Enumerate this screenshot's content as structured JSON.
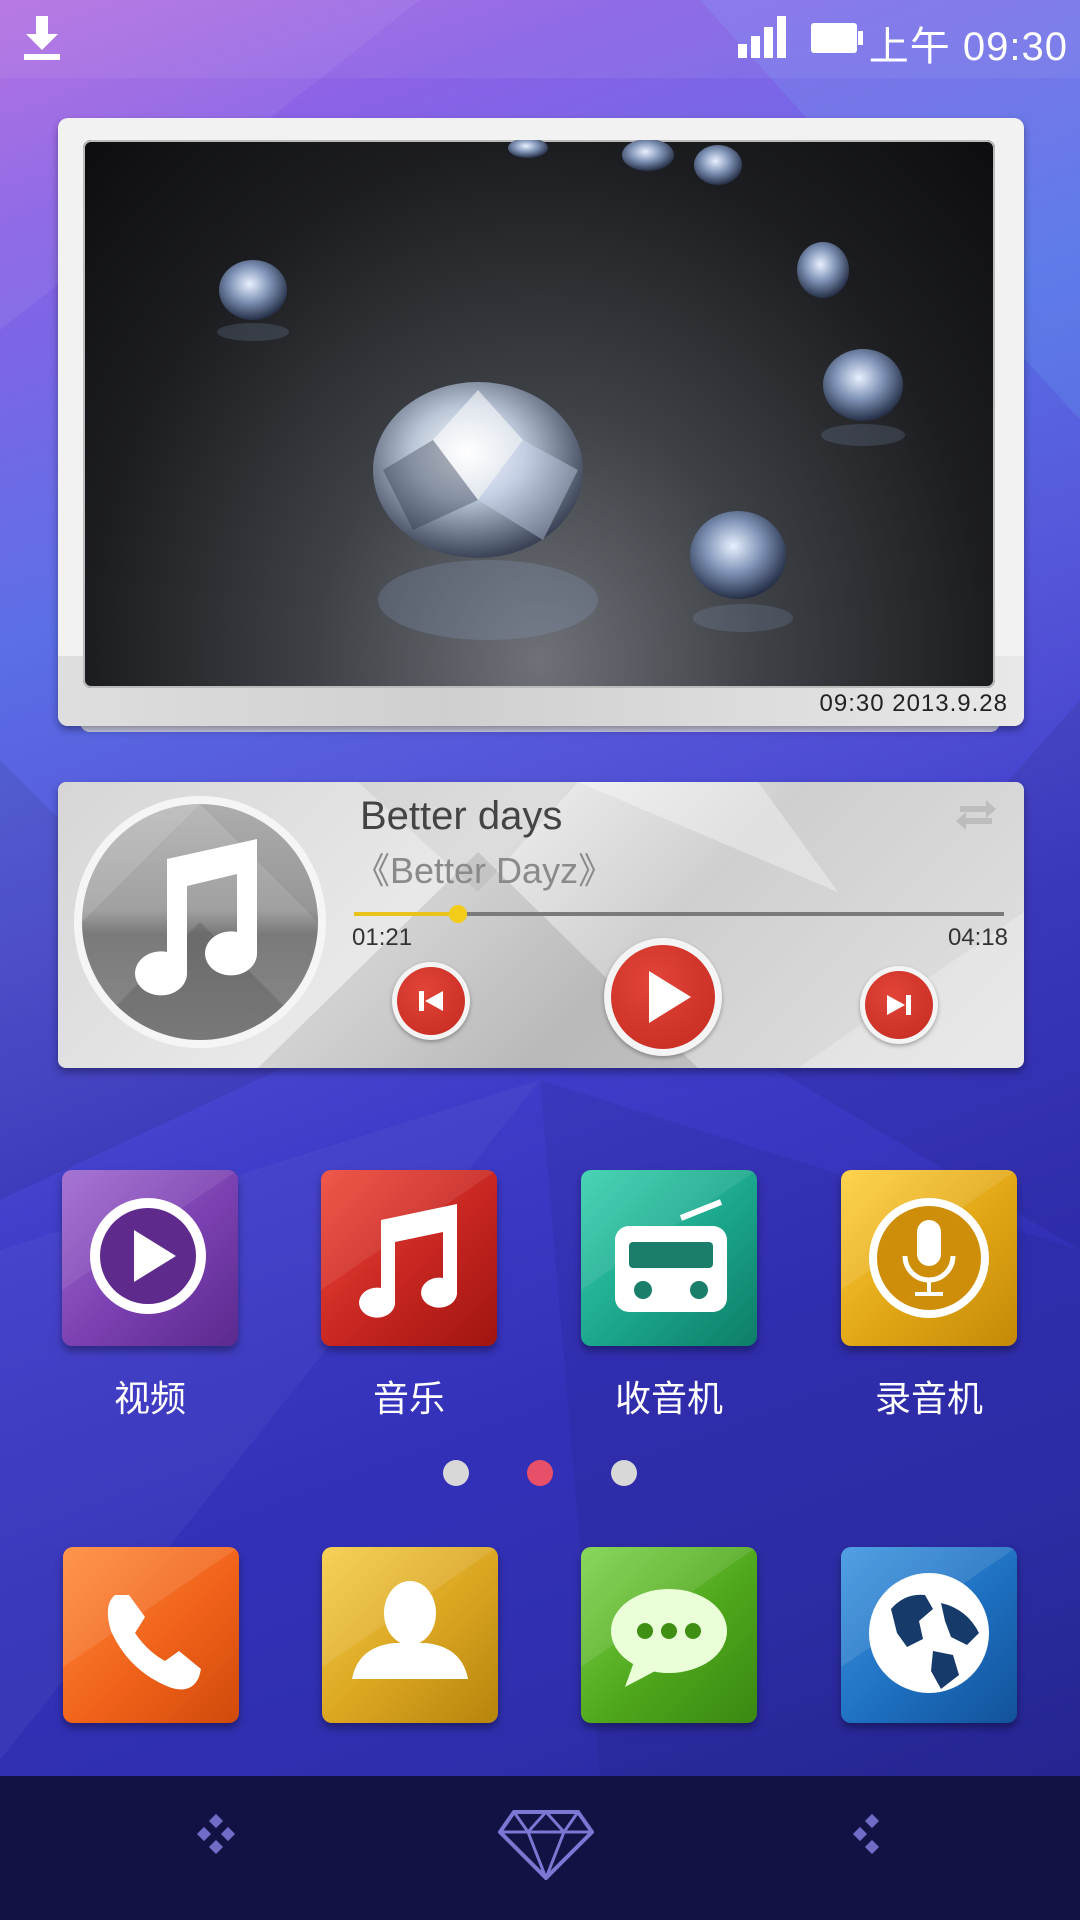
{
  "status_bar": {
    "time": "上午 09:30",
    "icons": [
      "download-icon",
      "signal-icon",
      "battery-icon"
    ]
  },
  "photo_widget": {
    "timestamp": "09:30  2013.9.28"
  },
  "music_widget": {
    "title": "Better days",
    "album": "《Better Dayz》",
    "elapsed": "01:21",
    "duration": "04:18",
    "progress": 0.16,
    "icons": [
      "music-note-icon",
      "repeat-icon",
      "previous-icon",
      "play-icon",
      "next-icon"
    ]
  },
  "apps_row1": [
    {
      "label": "视频",
      "icon": "video-icon",
      "color": "#7a3fb0"
    },
    {
      "label": "音乐",
      "icon": "music-icon",
      "color": "#c62520"
    },
    {
      "label": "收音机",
      "icon": "radio-icon",
      "color": "#1aa58a"
    },
    {
      "label": "录音机",
      "icon": "microphone-icon",
      "color": "#e0a514"
    }
  ],
  "page_indicator": {
    "count": 3,
    "active": 1
  },
  "apps_row2": [
    {
      "icon": "phone-icon",
      "color": "#f0621a"
    },
    {
      "icon": "contacts-icon",
      "color": "#d9a420"
    },
    {
      "icon": "messages-icon",
      "color": "#4fa71c"
    },
    {
      "icon": "browser-icon",
      "color": "#1e6fc0"
    }
  ],
  "dock": {
    "icons": [
      "left-menu-icon",
      "diamond-icon",
      "right-menu-icon"
    ]
  },
  "colors": {
    "accent_red": "#d3352b",
    "progress_yellow": "#e7c31c",
    "dock_bg": "#121245"
  }
}
